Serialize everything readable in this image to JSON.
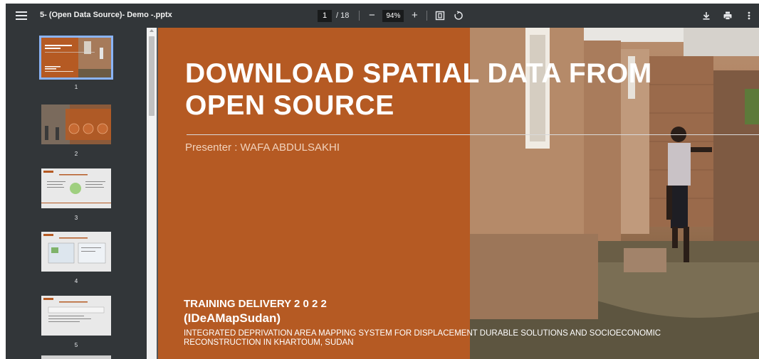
{
  "toolbar": {
    "menu_icon": "hamburger-menu-icon",
    "title": "5- (Open Data Source)- Demo -.pptx",
    "page_current": "1",
    "page_total": "/ 18",
    "zoom_out": "−",
    "zoom_value": "94%",
    "zoom_in": "+",
    "fit_icon": "fit-to-page-icon",
    "rotate_icon": "rotate-icon",
    "download_icon": "download-icon",
    "print_icon": "print-icon",
    "more_icon": "more-vert-icon"
  },
  "sidebar": {
    "thumbnails": [
      {
        "label": "1",
        "selected": true
      },
      {
        "label": "2",
        "selected": false
      },
      {
        "label": "3",
        "selected": false
      },
      {
        "label": "4",
        "selected": false
      },
      {
        "label": "5",
        "selected": false
      }
    ]
  },
  "slide": {
    "title": "DOWNLOAD SPATIAL  DATA FROM\nOPEN  SOURCE",
    "presenter": "Presenter : WAFA ABDULSAKHI",
    "training": "TRAINING DELIVERY 2 0 2 2",
    "acronym": "(IDeAMapSudan)",
    "description": "INTEGRATED DEPRIVATION AREA MAPPING SYSTEM FOR DISPLACEMENT DURABLE SOLUTIONS AND SOCIOECONOMIC RECONSTRUCTION IN KHARTOUM, SUDAN",
    "orange_color": "#b55a23"
  },
  "thumb1": {
    "title": "DOWNLOAD SPATIAL DATA FROM OPEN SOURCE"
  }
}
